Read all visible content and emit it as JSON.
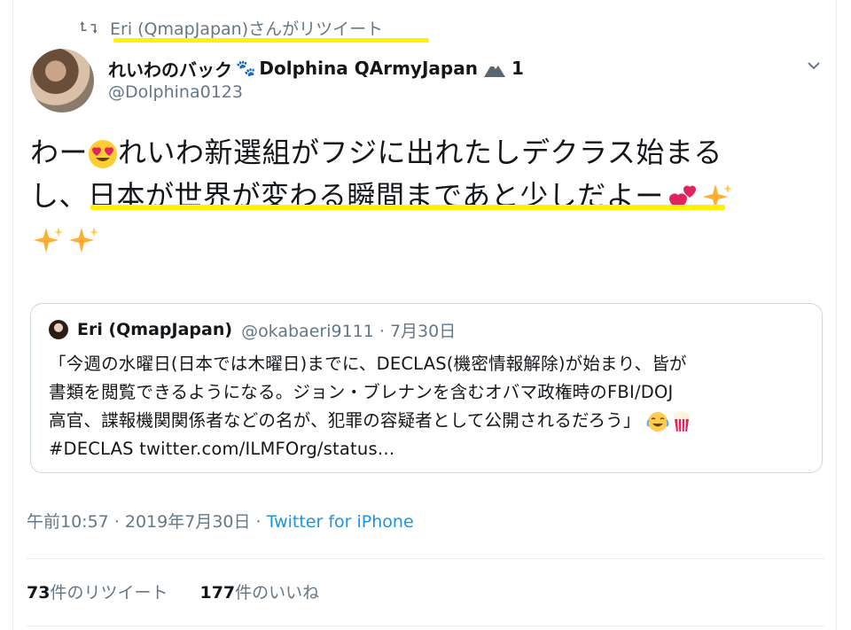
{
  "retweet": {
    "label": "Eri (QmapJapan)さんがリツイート"
  },
  "author": {
    "display_name": "れいわのバック",
    "display_name_rest": "Dolphina QArmyJapan",
    "name_suffix": "1",
    "handle": "@Dolphina0123"
  },
  "tweet": {
    "line1_a": "わー",
    "line1_b": "れいわ新選組がフジに出れたしデクラス始まる",
    "line2_a": "し、",
    "line2_b": "日本が世界が変わる瞬間まであと少しだよー"
  },
  "quote": {
    "name": "Eri (QmapJapan)",
    "meta": "@okabaeri9111 · 7月30日",
    "lines": [
      "「今週の水曜日(日本では木曜日)までに、DECLAS(機密情報解除)が始まり、皆が",
      "書類を閲覧できるようになる。ジョン・ブレナンを含むオバマ政権時のFBI/DOJ",
      "高官、諜報機関関係者などの名が、犯罪の容疑者として公開されるだろう」",
      "#DECLAS twitter.com/ILMFOrg/status…"
    ]
  },
  "timestamp": "午前10:57 · 2019年7月30日 · ",
  "via": "Twitter for iPhone",
  "stats": {
    "retweets_count": "73",
    "retweets_label": "件のリツイート",
    "likes_count": "177",
    "likes_label": "件のいいね"
  },
  "colors": {
    "highlight": "#fff200",
    "link": "#1b95e0",
    "muted": "#657786"
  },
  "icons": [
    "retweet-icon",
    "chevron-down-icon",
    "heart-eyes-emoji",
    "two-hearts-emoji",
    "sparkles-emoji",
    "joy-emoji",
    "popcorn-emoji",
    "paw-prints-emoji",
    "mountain-emoji"
  ]
}
